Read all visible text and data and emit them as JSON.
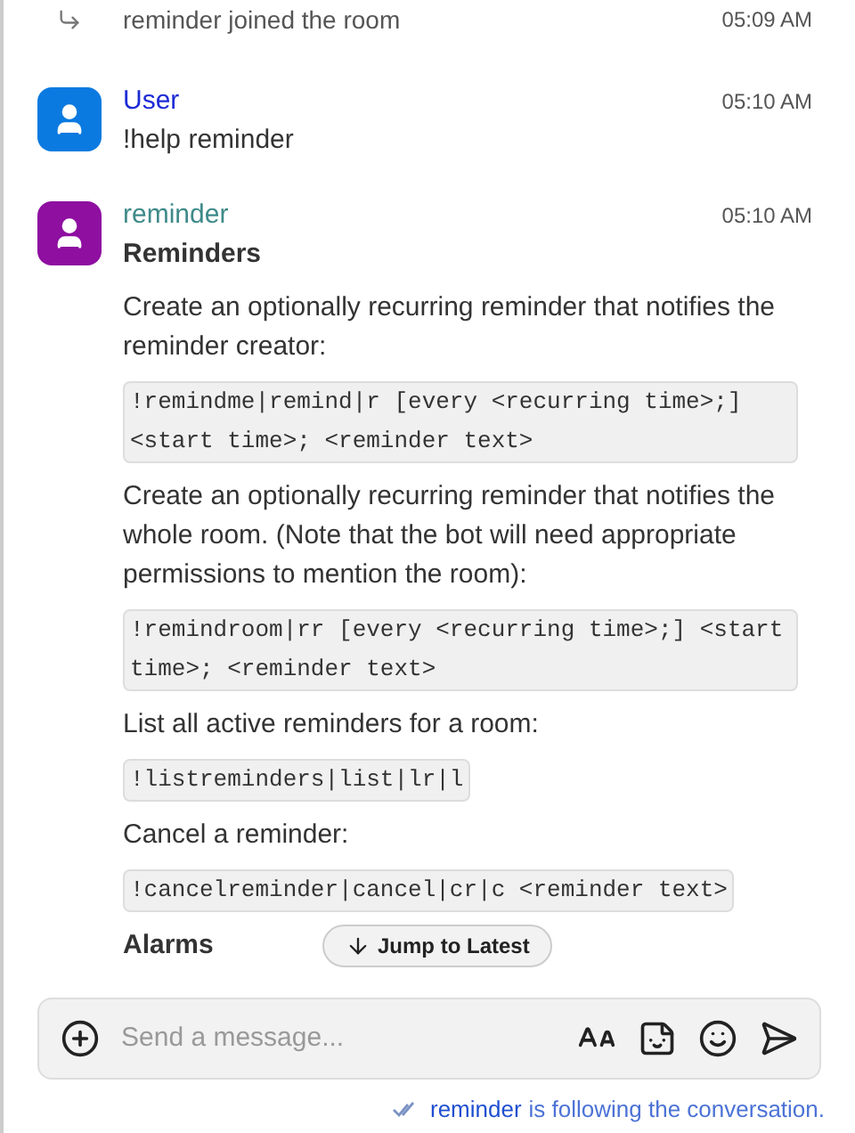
{
  "timeline": [
    {
      "kind": "membership",
      "text": "reminder joined the room",
      "time": "05:09 AM"
    },
    {
      "kind": "message",
      "sender": "User",
      "color": "#1d2bd6",
      "avatar": {
        "color": "#0b7ae0"
      },
      "time": "05:10 AM",
      "blocks": [
        {
          "kind": "paragraph",
          "text": "!help reminder"
        }
      ]
    },
    {
      "kind": "message",
      "sender": "reminder",
      "color": "#3f8a8a",
      "avatar": {
        "color": "#8e0fa0"
      },
      "time": "05:10 AM",
      "blocks": [
        {
          "kind": "heading",
          "text": "Reminders"
        },
        {
          "kind": "paragraph",
          "text": "Create an optionally recurring reminder that notifies the reminder creator:"
        },
        {
          "kind": "code",
          "text": "!remindme|remind|r [every <recurring time>;] <start time>; <reminder text>"
        },
        {
          "kind": "paragraph",
          "text": "Create an optionally recurring reminder that notifies the whole room. (Note that the bot will need appropriate permissions to mention the room):"
        },
        {
          "kind": "code",
          "text": "!remindroom|rr [every <recurring time>;] <start time>; <reminder text>"
        },
        {
          "kind": "paragraph",
          "text": "List all active reminders for a room:"
        },
        {
          "kind": "code",
          "text": "!listreminders|list|lr|l"
        },
        {
          "kind": "paragraph",
          "text": "Cancel a reminder:"
        },
        {
          "kind": "code",
          "text": "!cancelreminder|cancel|cr|c <reminder text>"
        },
        {
          "kind": "heading",
          "text": "Alarms"
        }
      ]
    }
  ],
  "jump_button": "Jump to Latest",
  "composer": {
    "placeholder": "Send a message..."
  },
  "following": {
    "name": "reminder",
    "text": "is following the conversation."
  }
}
